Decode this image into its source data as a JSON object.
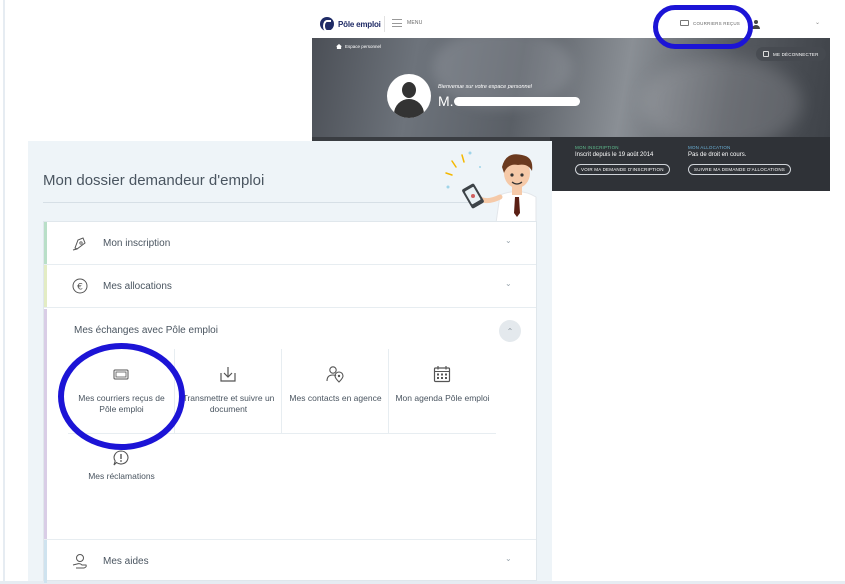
{
  "topbar": {
    "logo_text": "Pôle emploi",
    "menu_label": "MENU",
    "courriers_label": "COURRIERS REÇUS"
  },
  "hero": {
    "breadcrumb": "Espace personnel",
    "logout_label": "ME DÉCONNECTER",
    "welcome": "Bienvenue sur votre espace personnel",
    "name_prefix": "M."
  },
  "info_strip": {
    "inscription_tag": "MON INSCRIPTION",
    "inscription_value": "Inscrit depuis le 19 août 2014",
    "inscription_button": "VOIR MA DEMANDE D'INSCRIPTION",
    "allocation_tag": "MON ALLOCATION",
    "allocation_value": "Pas de droit en cours.",
    "allocation_button": "SUIVRE MA DEMANDE D'ALLOCATIONS"
  },
  "dossier": {
    "title": "Mon dossier demandeur d'emploi",
    "sections": {
      "inscription": "Mon inscription",
      "allocations": "Mes allocations",
      "echanges": "Mes échanges avec Pôle emploi",
      "aides": "Mes aides"
    },
    "tiles": {
      "courriers": "Mes courriers reçus de Pôle emploi",
      "transmettre": "Transmettre et suivre un document",
      "contacts": "Mes contacts en agence",
      "agenda": "Mon agenda Pôle emploi",
      "reclamations": "Mes réclamations"
    }
  },
  "colors": {
    "highlight": "#1c14d6",
    "stripe_inscription": "#b9dfc8",
    "stripe_allocations": "#e3ecc4",
    "stripe_echanges": "#d9cde6",
    "stripe_aides": "#cfe3ef"
  }
}
